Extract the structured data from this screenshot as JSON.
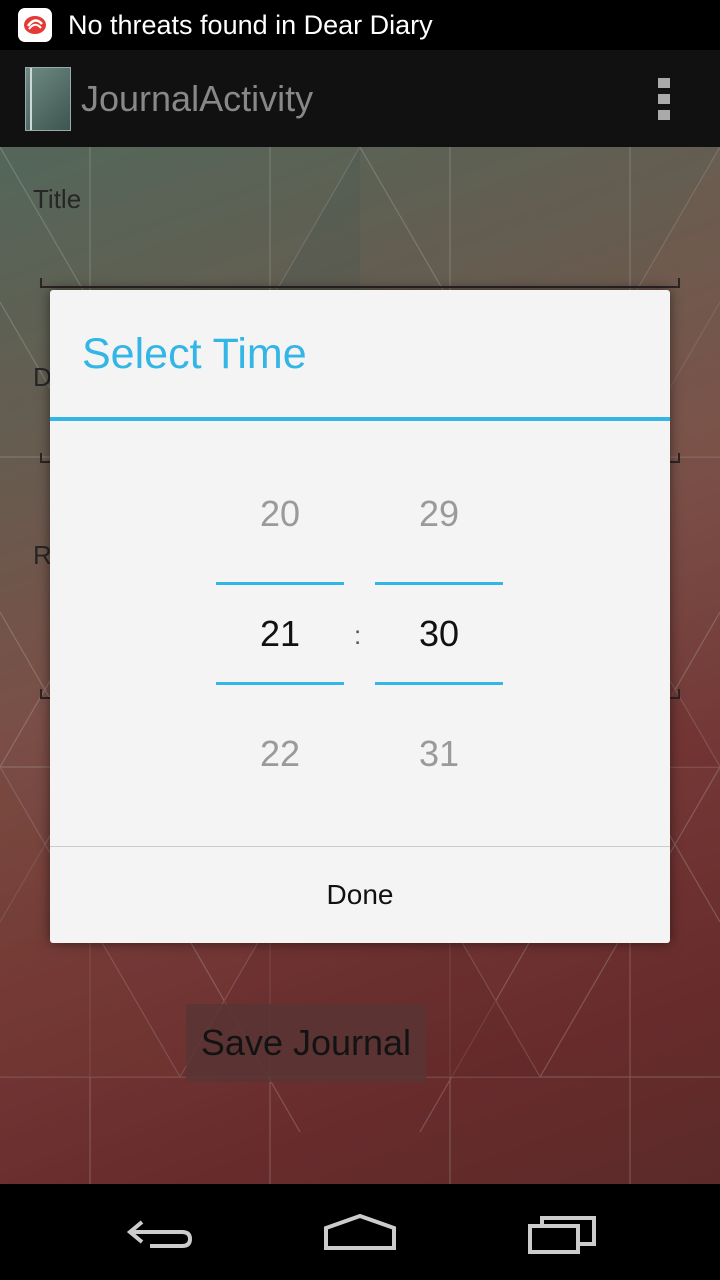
{
  "status_bar": {
    "notification_text": "No threats found in Dear Diary",
    "notification_icon": "antivirus-shield-icon"
  },
  "action_bar": {
    "title": "JournalActivity",
    "app_icon": "journal-notebook-icon",
    "overflow_icon": "overflow-menu-icon"
  },
  "form": {
    "title_label": "Title",
    "partial_label_1": "D",
    "partial_label_2": "R",
    "save_button": "Save Journal"
  },
  "dialog": {
    "title": "Select Time",
    "hours": {
      "prev": "20",
      "selected": "21",
      "next": "22"
    },
    "separator": ":",
    "minutes": {
      "prev": "29",
      "selected": "30",
      "next": "31"
    },
    "done_button": "Done"
  },
  "nav_bar": {
    "back_icon": "back-icon",
    "home_icon": "home-icon",
    "recents_icon": "recents-icon"
  },
  "colors": {
    "accent": "#33b5e5",
    "dialog_bg": "#f4f4f4",
    "status_bar_bg": "#000000"
  }
}
